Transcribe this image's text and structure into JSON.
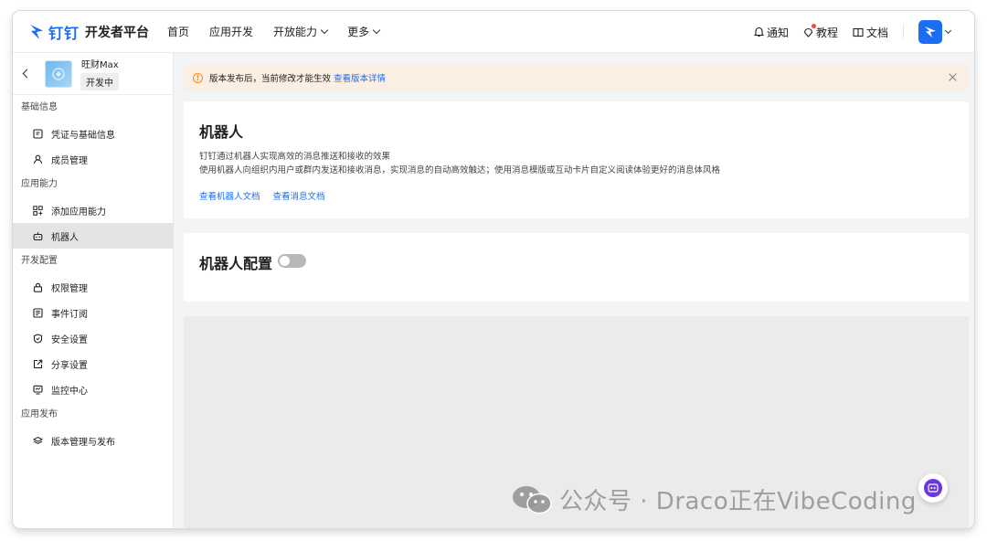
{
  "header": {
    "brand_name": "钉钉",
    "brand_title": "开发者平台",
    "menu": [
      {
        "label": "首页",
        "dropdown": false
      },
      {
        "label": "应用开发",
        "dropdown": false
      },
      {
        "label": "开放能力",
        "dropdown": true
      },
      {
        "label": "更多",
        "dropdown": true
      }
    ],
    "notify_label": "通知",
    "tutorial_label": "教程",
    "docs_label": "文档"
  },
  "sidebar": {
    "app_name": "旺财Max",
    "app_status": "开发中",
    "groups": [
      {
        "label": "基础信息",
        "items": [
          {
            "label": "凭证与基础信息",
            "icon": "credential-icon"
          },
          {
            "label": "成员管理",
            "icon": "user-icon"
          }
        ]
      },
      {
        "label": "应用能力",
        "items": [
          {
            "label": "添加应用能力",
            "icon": "grid-add-icon"
          },
          {
            "label": "机器人",
            "icon": "robot-icon",
            "active": true
          }
        ]
      },
      {
        "label": "开发配置",
        "items": [
          {
            "label": "权限管理",
            "icon": "lock-icon"
          },
          {
            "label": "事件订阅",
            "icon": "event-icon"
          },
          {
            "label": "安全设置",
            "icon": "shield-icon"
          },
          {
            "label": "分享设置",
            "icon": "share-icon"
          },
          {
            "label": "监控中心",
            "icon": "monitor-icon"
          }
        ]
      },
      {
        "label": "应用发布",
        "items": [
          {
            "label": "版本管理与发布",
            "icon": "layers-icon"
          }
        ]
      }
    ]
  },
  "alert": {
    "text": "版本发布后，当前修改才能生效",
    "link": "查看版本详情"
  },
  "robot_card": {
    "title": "机器人",
    "desc_line1": "钉钉通过机器人实现高效的消息推送和接收的效果",
    "desc_line2": "使用机器人向组织内用户或群内发送和接收消息，实现消息的自动高效触达；使用消息模版或互动卡片自定义阅读体验更好的消息体风格",
    "link_robot_docs": "查看机器人文档",
    "link_message_docs": "查看消息文档"
  },
  "config_card": {
    "title": "机器人配置",
    "toggle_on": false
  },
  "watermark": {
    "text": "公众号 · Draco正在VibeCoding"
  },
  "colors": {
    "accent": "#1b6ef3",
    "alert_bg": "#fbeee2",
    "warning": "#f08a24",
    "active_nav_bg": "#e4e4e6",
    "assistant": "#6a37e0"
  }
}
